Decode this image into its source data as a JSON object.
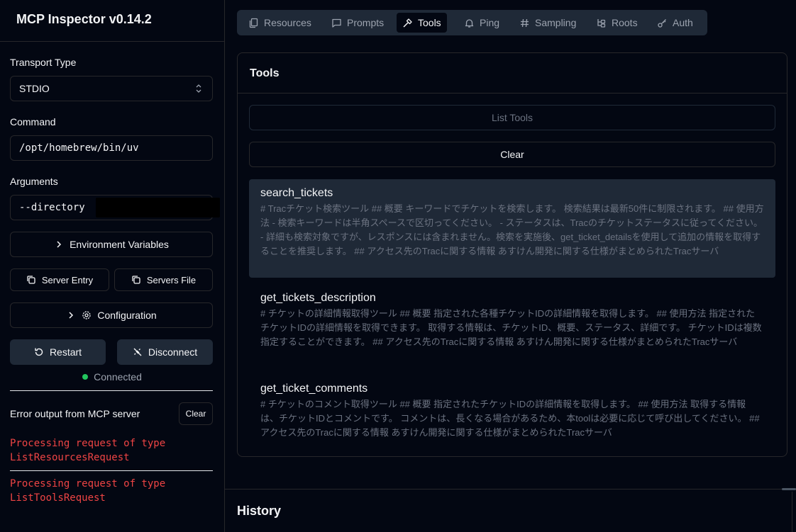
{
  "app": {
    "title": "MCP Inspector v0.14.2"
  },
  "sidebar": {
    "transport_label": "Transport Type",
    "transport_value": "STDIO",
    "command_label": "Command",
    "command_value": "/opt/homebrew/bin/uv",
    "arguments_label": "Arguments",
    "arguments_value": "--directory",
    "env_button": "Environment Variables",
    "server_entry_button": "Server Entry",
    "servers_file_button": "Servers File",
    "configuration_button": "Configuration",
    "restart_button": "Restart",
    "disconnect_button": "Disconnect",
    "status": "Connected",
    "status_color": "#22c55e",
    "error_title": "Error output from MCP server",
    "error_clear": "Clear",
    "errors": [
      "Processing request of type ListResourcesRequest",
      "Processing request of type ListToolsRequest"
    ]
  },
  "tabs": [
    {
      "label": "Resources",
      "icon": "files-icon"
    },
    {
      "label": "Prompts",
      "icon": "message-square-icon"
    },
    {
      "label": "Tools",
      "icon": "hammer-icon",
      "active": true
    },
    {
      "label": "Ping",
      "icon": "bell-icon"
    },
    {
      "label": "Sampling",
      "icon": "hash-icon"
    },
    {
      "label": "Roots",
      "icon": "folder-tree-icon"
    },
    {
      "label": "Auth",
      "icon": "key-icon"
    }
  ],
  "tools": {
    "title": "Tools",
    "list_button": "List Tools",
    "clear_button": "Clear",
    "items": [
      {
        "name": "search_tickets",
        "description": "# Tracチケット検索ツール ## 概要 キーワードでチケットを検索します。 検索結果は最新50件に制限されます。 ## 使用方法 - 検索キーワードは半角スペースで区切ってください。 - ステータスは、Tracのチケットステータスに従ってください。 - 詳細も検索対象ですが、レスポンスには含まれません。検索を実施後、get_ticket_detailsを使用して追加の情報を取得することを推奨します。 ## アクセス先のTracに関する情報 あすけん開発に関する仕様がまとめられたTracサーバ"
      },
      {
        "name": "get_tickets_description",
        "description": "# チケットの詳細情報取得ツール ## 概要 指定された各種チケットIDの詳細情報を取得します。 ## 使用方法 指定されたチケットIDの詳細情報を取得できます。 取得する情報は、チケットID、概要、ステータス、詳細です。 チケットIDは複数指定することができます。 ## アクセス先のTracに関する情報 あすけん開発に関する仕様がまとめられたTracサーバ"
      },
      {
        "name": "get_ticket_comments",
        "description": "# チケットのコメント取得ツール ## 概要 指定されたチケットIDの詳細情報を取得します。 ## 使用方法 取得する情報は、チケットIDとコメントです。 コメントは、長くなる場合があるため、本toolは必要に応じて呼び出してください。 ## アクセス先のTracに関する情報 あすけん開発に関する仕様がまとめられたTracサーバ"
      }
    ]
  },
  "history": {
    "title": "History"
  }
}
